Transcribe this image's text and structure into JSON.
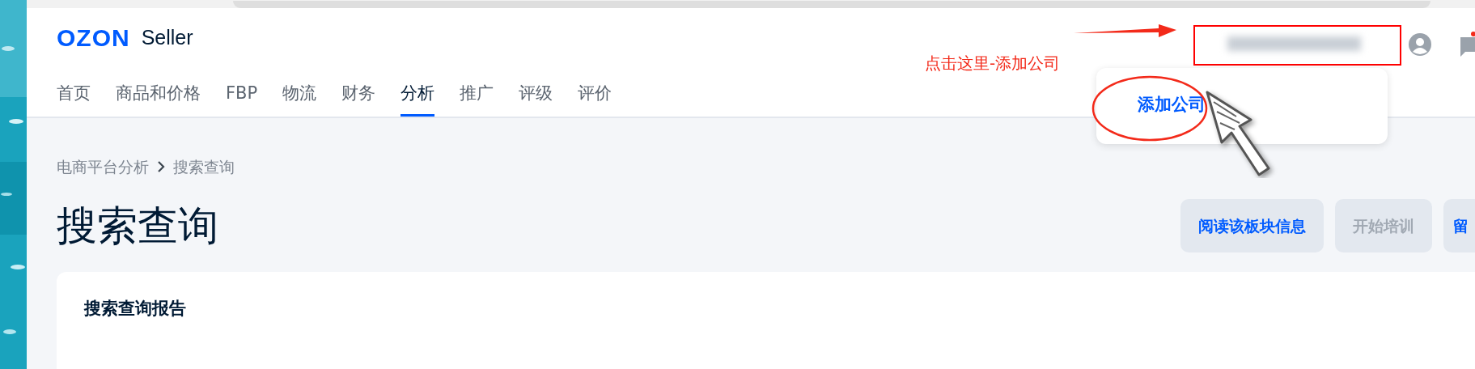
{
  "logo": {
    "brand": "OZON",
    "product": "Seller"
  },
  "nav": [
    {
      "label": "首页",
      "selected": false
    },
    {
      "label": "商品和价格",
      "selected": false
    },
    {
      "label": "FBP",
      "selected": false
    },
    {
      "label": "物流",
      "selected": false
    },
    {
      "label": "财务",
      "selected": false
    },
    {
      "label": "分析",
      "selected": true
    },
    {
      "label": "推广",
      "selected": false
    },
    {
      "label": "评级",
      "selected": false
    },
    {
      "label": "评价",
      "selected": false
    }
  ],
  "annotation": {
    "text": "点击这里-添加公司"
  },
  "account_menu": {
    "items": [
      {
        "label": "添加公司"
      }
    ]
  },
  "breadcrumb": [
    {
      "label": "电商平台分析"
    },
    {
      "label": "搜索查询"
    }
  ],
  "page_title": "搜索查询",
  "actions": [
    {
      "label": "阅读该板块信息",
      "disabled": false
    },
    {
      "label": "开始培训",
      "disabled": true
    },
    {
      "label": "留",
      "disabled": false
    }
  ],
  "report": {
    "title": "搜索查询报告"
  }
}
